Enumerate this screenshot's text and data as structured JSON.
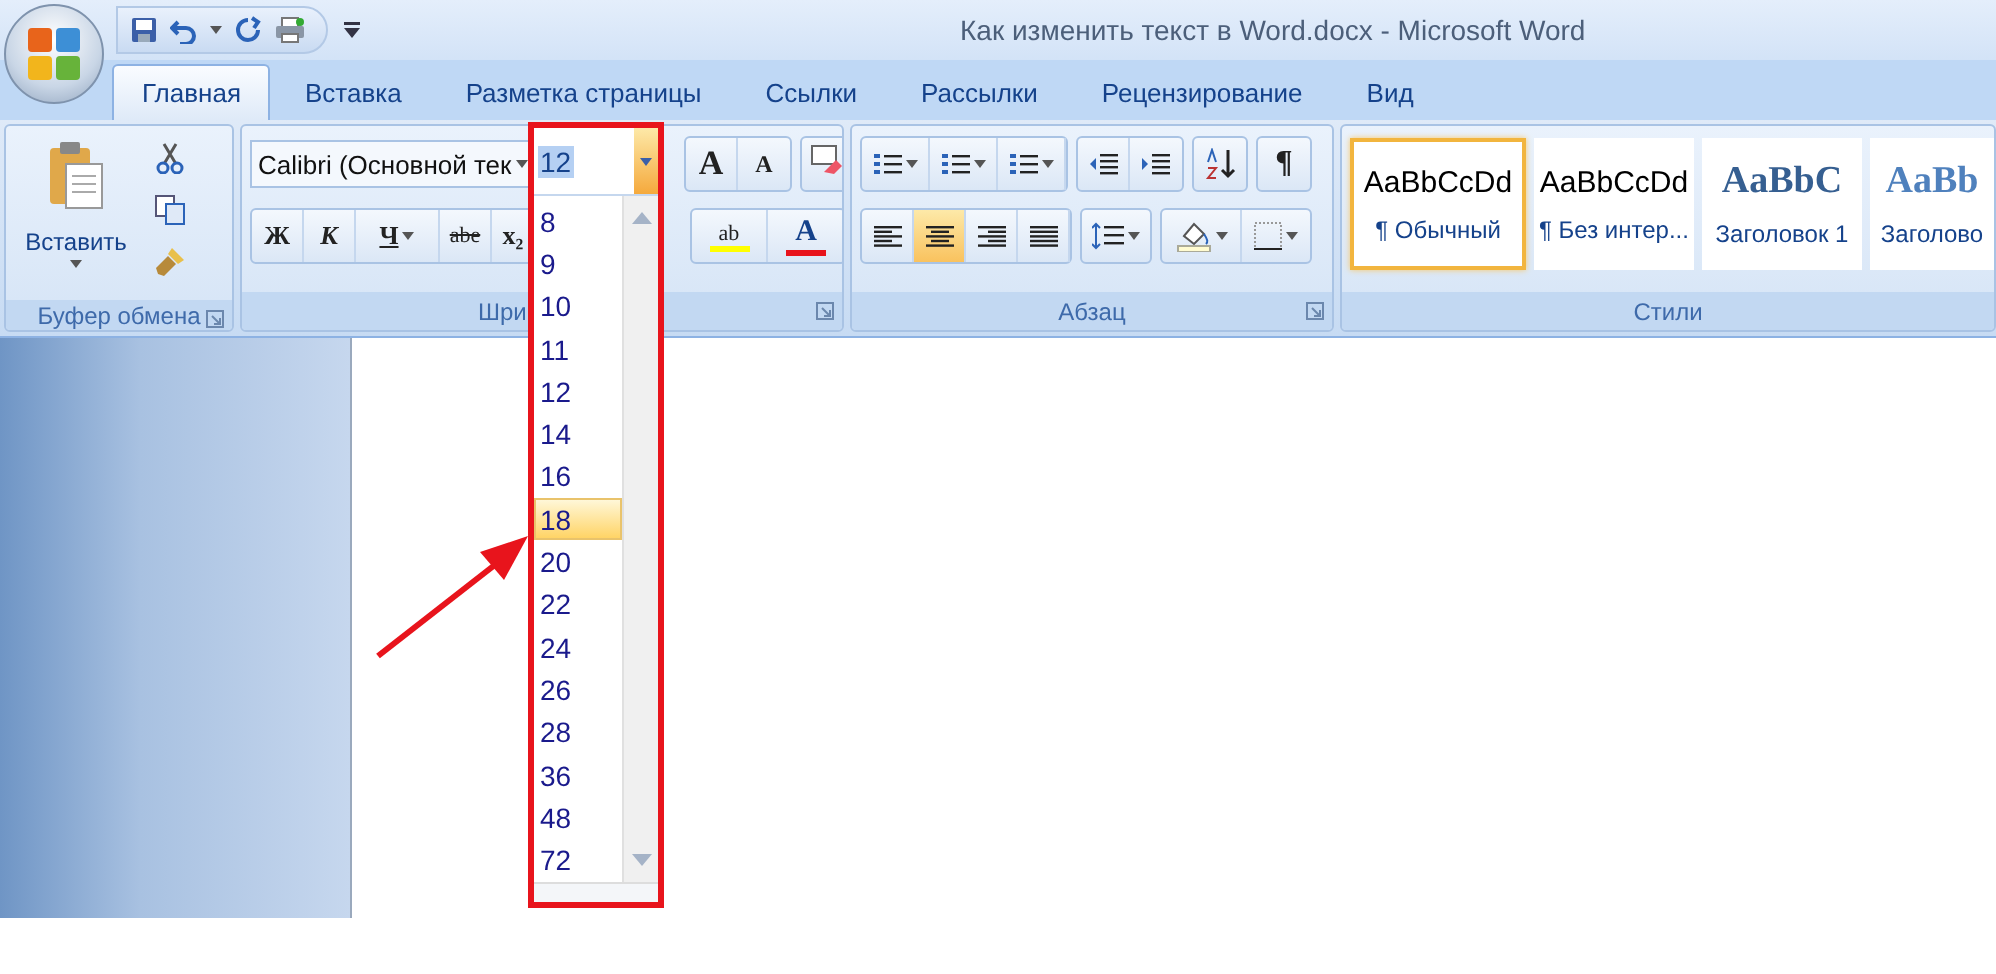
{
  "window": {
    "title": "Как изменить текст в Word.docx - Microsoft Word"
  },
  "tabs": [
    {
      "label": "Главная",
      "selected": true
    },
    {
      "label": "Вставка",
      "selected": false
    },
    {
      "label": "Разметка страницы",
      "selected": false
    },
    {
      "label": "Ссылки",
      "selected": false
    },
    {
      "label": "Рассылки",
      "selected": false
    },
    {
      "label": "Рецензирование",
      "selected": false
    },
    {
      "label": "Вид",
      "selected": false
    }
  ],
  "ribbon": {
    "clipboard": {
      "paste_label": "Вставить",
      "group_label": "Буфер обмена"
    },
    "font": {
      "font_name": "Calibri (Основной тек",
      "grow_label": "A",
      "shrink_label": "A",
      "format_buttons": [
        {
          "kind": "bold",
          "label": "Ж"
        },
        {
          "kind": "italic",
          "label": "К"
        },
        {
          "kind": "underline",
          "label": "Ч"
        },
        {
          "kind": "strike",
          "label": "abe"
        },
        {
          "kind": "subscript",
          "label": "x₂"
        }
      ],
      "highlight_label": "ab",
      "color_label": "A",
      "group_label": "Шри"
    },
    "paragraph": {
      "show_marks_label": "¶",
      "align": [
        {
          "kind": "left",
          "selected": false
        },
        {
          "kind": "center",
          "selected": true
        },
        {
          "kind": "right",
          "selected": false
        },
        {
          "kind": "justify",
          "selected": false
        }
      ],
      "group_label": "Абзац"
    },
    "styles": {
      "items": [
        {
          "kind": "normal",
          "preview": "AaBbCcDd",
          "name": "¶ Обычный",
          "selected": true
        },
        {
          "kind": "normal",
          "preview": "AaBbCcDd",
          "name": "¶ Без интер...",
          "selected": false
        },
        {
          "kind": "heading1",
          "preview": "AaBbC",
          "name": "Заголовок 1",
          "selected": false
        },
        {
          "kind": "heading2",
          "preview": "AaBb",
          "name": "Заголово",
          "selected": false
        }
      ],
      "group_label": "Стили"
    }
  },
  "size_dropdown": {
    "value": "12",
    "options": [
      {
        "label": "8",
        "highlighted": false
      },
      {
        "label": "9",
        "highlighted": false
      },
      {
        "label": "10",
        "highlighted": false
      },
      {
        "label": "11",
        "highlighted": false
      },
      {
        "label": "12",
        "highlighted": false
      },
      {
        "label": "14",
        "highlighted": false
      },
      {
        "label": "16",
        "highlighted": false
      },
      {
        "label": "18",
        "highlighted": true
      },
      {
        "label": "20",
        "highlighted": false
      },
      {
        "label": "22",
        "highlighted": false
      },
      {
        "label": "24",
        "highlighted": false
      },
      {
        "label": "26",
        "highlighted": false
      },
      {
        "label": "28",
        "highlighted": false
      },
      {
        "label": "36",
        "highlighted": false
      },
      {
        "label": "48",
        "highlighted": false
      },
      {
        "label": "72",
        "highlighted": false
      }
    ]
  }
}
